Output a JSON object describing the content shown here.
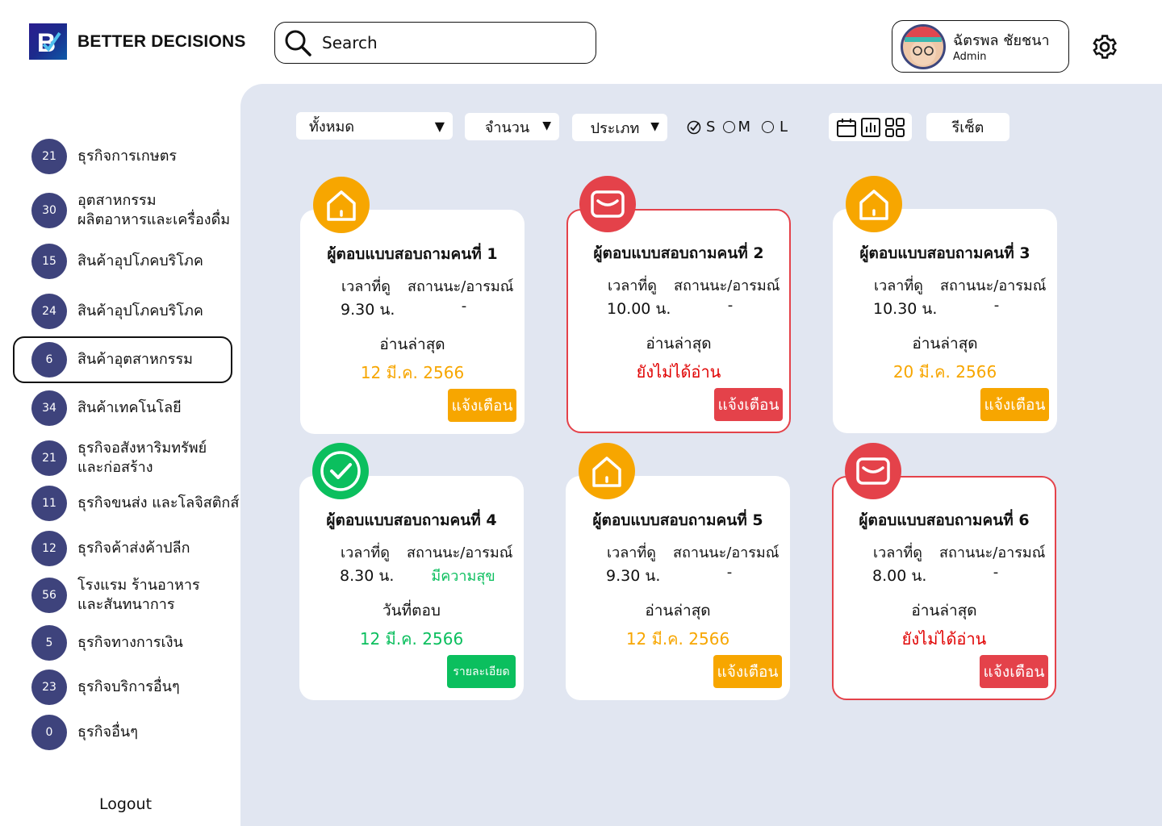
{
  "header": {
    "brand": "BETTER DECISIONS",
    "search_placeholder": "Search",
    "user": {
      "name": "ฉัตรพล ชัยชนา",
      "role": "Admin"
    }
  },
  "sidebar": {
    "items": [
      {
        "count": "21",
        "label": [
          "ธุรกิจการเกษตร"
        ]
      },
      {
        "count": "30",
        "label": [
          "อุตสาหกรรม",
          "ผลิตอาหารและเครื่องดื่ม"
        ]
      },
      {
        "count": "15",
        "label": [
          "สินค้าอุปโภคบริโภค"
        ]
      },
      {
        "count": "24",
        "label": [
          "สินค้าอุปโภคบริโภค"
        ]
      },
      {
        "count": "6",
        "label": [
          "สินค้าอุตสาหกรรม"
        ]
      },
      {
        "count": "34",
        "label": [
          "สินค้าเทคโนโลยี"
        ]
      },
      {
        "count": "21",
        "label": [
          "ธุรกิจอสังหาริมทรัพย์",
          "และก่อสร้าง"
        ]
      },
      {
        "count": "11",
        "label": [
          "ธุรกิจขนส่ง และโลจิสติกส์"
        ]
      },
      {
        "count": "12",
        "label": [
          "ธุรกิจค้าส่งค้าปลีก"
        ]
      },
      {
        "count": "56",
        "label": [
          "โรงแรม ร้านอาหาร",
          "และสันทนาการ"
        ]
      },
      {
        "count": "5",
        "label": [
          "ธุรกิจทางการเงิน"
        ]
      },
      {
        "count": "23",
        "label": [
          "ธุรกิจบริการอื่นๆ"
        ]
      },
      {
        "count": "0",
        "label": [
          "ธุรกิจอื่นๆ"
        ]
      }
    ],
    "logout": "Logout"
  },
  "filters": {
    "all": "ทั้งหมด",
    "amount": "จำนวน",
    "type": "ประเภท",
    "sizes": [
      "S",
      "M",
      "L"
    ],
    "reset": "รีเซ็ต"
  },
  "cards": [
    {
      "title": "ผู้ตอบแบบสอบถามคนที่ 1",
      "time_label": "เวลาที่ดู",
      "status_label": "สถานนะ/อารมณ์",
      "time": "9.30 น.",
      "status": "-",
      "read_label": "อ่านล่าสุด",
      "read_value": "12 มี.ค. 2566",
      "button": "แจ้งเตือน"
    },
    {
      "title": "ผู้ตอบแบบสอบถามคนที่ 2",
      "time_label": "เวลาที่ดู",
      "status_label": "สถานนะ/อารมณ์",
      "time": "10.00 น.",
      "status": "-",
      "read_label": "อ่านล่าสุด",
      "read_value": "ยังไม่ได้อ่าน",
      "button": "แจ้งเตือน"
    },
    {
      "title": "ผู้ตอบแบบสอบถามคนที่ 3",
      "time_label": "เวลาที่ดู",
      "status_label": "สถานนะ/อารมณ์",
      "time": "10.30 น.",
      "status": "-",
      "read_label": "อ่านล่าสุด",
      "read_value": "20 มี.ค. 2566",
      "button": "แจ้งเตือน"
    },
    {
      "title": "ผู้ตอบแบบสอบถามคนที่ 4",
      "time_label": "เวลาที่ดู",
      "status_label": "สถานนะ/อารมณ์",
      "time": "8.30 น.",
      "status": "มีความสุข",
      "read_label": "วันที่ตอบ",
      "read_value": "12 มี.ค. 2566",
      "button": "รายละเอียด"
    },
    {
      "title": "ผู้ตอบแบบสอบถามคนที่ 5",
      "time_label": "เวลาที่ดู",
      "status_label": "สถานนะ/อารมณ์",
      "time": "9.30 น.",
      "status": "-",
      "read_label": "อ่านล่าสุด",
      "read_value": "12 มี.ค. 2566",
      "button": "แจ้งเตือน"
    },
    {
      "title": "ผู้ตอบแบบสอบถามคนที่ 6",
      "time_label": "เวลาที่ดู",
      "status_label": "สถานนะ/อารมณ์",
      "time": "8.00 น.",
      "status": "-",
      "read_label": "อ่านล่าสุด",
      "read_value": "ยังไม่ได้อ่าน",
      "button": "แจ้งเตือน"
    }
  ],
  "colors": {
    "orange": "#f7a600",
    "red": "#e4424a",
    "green": "#0bbf5e",
    "badge": "#3e437c",
    "main_bg": "#e1e6f1"
  }
}
